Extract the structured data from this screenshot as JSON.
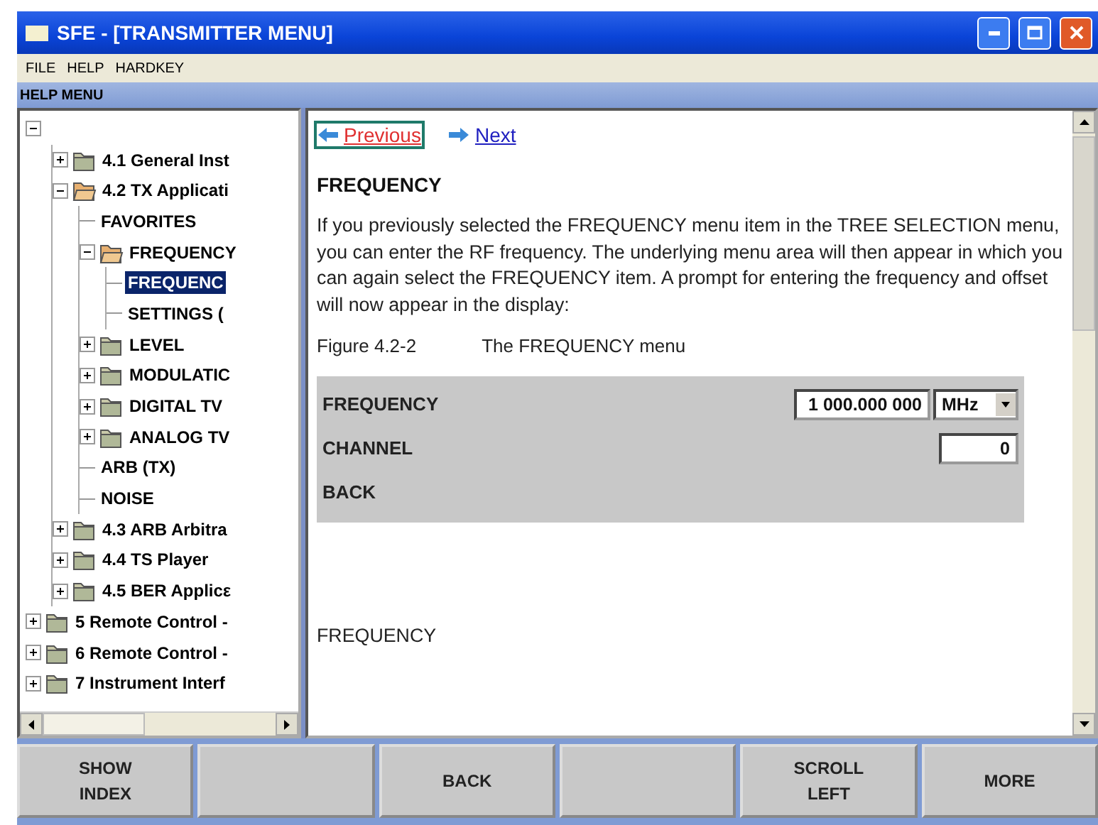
{
  "window": {
    "title": "SFE - [TRANSMITTER MENU]"
  },
  "menu": [
    "FILE",
    "HELP",
    "HARDKEY"
  ],
  "panel_title": "HELP MENU",
  "tree": {
    "items": [
      {
        "kind": "folder",
        "expanded": true,
        "children": [
          {
            "kind": "folder",
            "label": "4.1 General Inst",
            "expanded": false,
            "selected": false
          },
          {
            "kind": "folder",
            "label": "4.2 TX Applicati",
            "expanded": true,
            "selected": false,
            "children": [
              {
                "kind": "leaf",
                "label": "FAVORITES",
                "selected": false
              },
              {
                "kind": "folder",
                "label": "FREQUENCY",
                "expanded": true,
                "selected": false,
                "children": [
                  {
                    "kind": "leaf",
                    "label": "FREQUENC",
                    "selected": true
                  },
                  {
                    "kind": "leaf",
                    "label": "SETTINGS (",
                    "selected": false
                  }
                ]
              },
              {
                "kind": "folder",
                "label": "LEVEL",
                "expanded": false,
                "selected": false
              },
              {
                "kind": "folder",
                "label": "MODULATIC",
                "expanded": false,
                "selected": false
              },
              {
                "kind": "folder",
                "label": "DIGITAL TV",
                "expanded": false,
                "selected": false
              },
              {
                "kind": "folder",
                "label": "ANALOG TV",
                "expanded": false,
                "selected": false
              },
              {
                "kind": "leaf",
                "label": "ARB (TX)",
                "selected": false
              },
              {
                "kind": "leaf",
                "label": "NOISE",
                "selected": false
              }
            ]
          },
          {
            "kind": "folder",
            "label": "4.3 ARB Arbitra",
            "expanded": false,
            "selected": false
          },
          {
            "kind": "folder",
            "label": "4.4 TS Player",
            "expanded": false,
            "selected": false
          },
          {
            "kind": "folder",
            "label": "4.5 BER Applicε",
            "expanded": false,
            "selected": false
          }
        ]
      },
      {
        "kind": "folder",
        "label": "5 Remote Control -",
        "expanded": false,
        "selected": false
      },
      {
        "kind": "folder",
        "label": "6 Remote Control -",
        "expanded": false,
        "selected": false
      },
      {
        "kind": "folder",
        "label": "7 Instrument Interf",
        "expanded": false,
        "selected": false
      }
    ]
  },
  "help": {
    "nav": [
      {
        "label": "Previous",
        "kind": "back",
        "focused": true
      },
      {
        "label": "Next",
        "kind": "forward",
        "focused": false
      }
    ],
    "heading": "FREQUENCY",
    "paragraph": "If you previously selected the FREQUENCY menu item in the TREE SELECTION menu, you can enter the RF frequency. The underlying menu area will then appear in which you can again select the FREQUENCY item. A prompt for entering the frequency and offset will now appear in the display:",
    "figure_number": "Figure 4.2-2",
    "figure_caption": "The FREQUENCY menu",
    "figure_rows": [
      {
        "label": "FREQUENCY",
        "kind": "value_unit",
        "value": "1 000.000 000",
        "unit": "MHz"
      },
      {
        "label": "CHANNEL",
        "kind": "value",
        "value": "0"
      },
      {
        "label": "BACK",
        "kind": "plain"
      }
    ],
    "subheading": "FREQUENCY"
  },
  "softkeys": [
    {
      "kind": "label",
      "lines": [
        "SHOW",
        "INDEX"
      ]
    },
    {
      "kind": "blank"
    },
    {
      "kind": "label",
      "lines": [
        "BACK"
      ]
    },
    {
      "kind": "blank"
    },
    {
      "kind": "label",
      "lines": [
        "SCROLL",
        "LEFT"
      ]
    },
    {
      "kind": "label",
      "lines": [
        "MORE"
      ]
    }
  ]
}
